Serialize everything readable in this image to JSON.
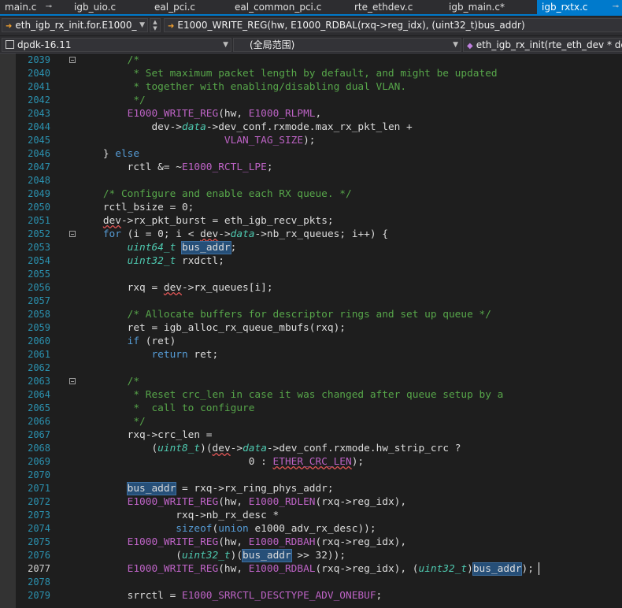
{
  "tabs": [
    {
      "label": "main.c",
      "active": false,
      "pinned": true
    },
    {
      "label": "igb_uio.c",
      "active": false,
      "pinned": false
    },
    {
      "label": "eal_pci.c",
      "active": false,
      "pinned": false
    },
    {
      "label": "eal_common_pci.c",
      "active": false,
      "pinned": false
    },
    {
      "label": "rte_ethdev.c",
      "active": false,
      "pinned": false
    },
    {
      "label": "igb_main.c*",
      "active": false,
      "pinned": false
    },
    {
      "label": "igb_rxtx.c",
      "active": true,
      "pinned": true
    }
  ],
  "nav": {
    "function_combo": "eth_igb_rx_init.for.E1000_",
    "member_combo": "E1000_WRITE_REG(hw, E1000_RDBAL(rxq->reg_idx), (uint32_t)bus_addr)"
  },
  "scope": {
    "project": "dpdk-16.11",
    "scope_label": "(全局范围)",
    "function": "eth_igb_rx_init(rte_eth_dev * dev"
  },
  "gutter": {
    "line_numbers": [
      "2039",
      "2040",
      "2041",
      "2042",
      "2043",
      "2044",
      "2045",
      "2046",
      "2047",
      "2048",
      "2049",
      "2050",
      "2051",
      "2052",
      "2053",
      "2054",
      "2055",
      "2056",
      "2057",
      "2058",
      "2059",
      "2060",
      "2061",
      "2062",
      "2063",
      "2064",
      "2065",
      "2066",
      "2067",
      "2068",
      "2069",
      "2070",
      "2071",
      "2072",
      "2073",
      "2074",
      "2075",
      "2076",
      "2077",
      "2078",
      "2079"
    ],
    "current_line": "2077"
  },
  "code_lines": [
    [
      {
        "t": "        "
      },
      {
        "t": "/*",
        "c": "cm"
      }
    ],
    [
      {
        "t": "         "
      },
      {
        "t": "* Set maximum packet length by default, and might be updated",
        "c": "cm"
      }
    ],
    [
      {
        "t": "         "
      },
      {
        "t": "* together with enabling/disabling dual VLAN.",
        "c": "cm"
      }
    ],
    [
      {
        "t": "         "
      },
      {
        "t": "*/",
        "c": "cm"
      }
    ],
    [
      {
        "t": "        "
      },
      {
        "t": "E1000_WRITE_REG",
        "c": "mac"
      },
      {
        "t": "(hw, "
      },
      {
        "t": "E1000_RLPML",
        "c": "mac"
      },
      {
        "t": ","
      }
    ],
    [
      {
        "t": "            dev->"
      },
      {
        "t": "data",
        "c": "ty"
      },
      {
        "t": "->dev_conf.rxmode.max_rx_pkt_len +"
      }
    ],
    [
      {
        "t": "                        "
      },
      {
        "t": "VLAN_TAG_SIZE",
        "c": "mac"
      },
      {
        "t": ");"
      }
    ],
    [
      {
        "t": "    } "
      },
      {
        "t": "else",
        "c": "kw"
      }
    ],
    [
      {
        "t": "        rctl &= ~"
      },
      {
        "t": "E1000_RCTL_LPE",
        "c": "mac"
      },
      {
        "t": ";"
      }
    ],
    [
      {
        "t": ""
      }
    ],
    [
      {
        "t": "    "
      },
      {
        "t": "/* Configure and enable each RX queue. */",
        "c": "cm"
      }
    ],
    [
      {
        "t": "    rctl_bsize = 0;"
      }
    ],
    [
      {
        "t": "    "
      },
      {
        "t": "dev",
        "s": true
      },
      {
        "t": "->rx_pkt_burst = eth_igb_recv_pkts;"
      }
    ],
    [
      {
        "t": "    "
      },
      {
        "t": "for",
        "c": "kw"
      },
      {
        "t": " (i = 0; i < "
      },
      {
        "t": "dev",
        "s": true
      },
      {
        "t": "->"
      },
      {
        "t": "data",
        "c": "ty"
      },
      {
        "t": "->nb_rx_queues; i++) {"
      }
    ],
    [
      {
        "t": "        "
      },
      {
        "t": "uint64_t",
        "c": "ty"
      },
      {
        "t": " "
      },
      {
        "t": "bus_addr",
        "h": true
      },
      {
        "t": ";"
      }
    ],
    [
      {
        "t": "        "
      },
      {
        "t": "uint32_t",
        "c": "ty"
      },
      {
        "t": " rxdctl;"
      }
    ],
    [
      {
        "t": ""
      }
    ],
    [
      {
        "t": "        rxq = "
      },
      {
        "t": "dev",
        "s": true
      },
      {
        "t": "->rx_queues[i];"
      }
    ],
    [
      {
        "t": ""
      }
    ],
    [
      {
        "t": "        "
      },
      {
        "t": "/* Allocate buffers for descriptor rings and set up queue */",
        "c": "cm"
      }
    ],
    [
      {
        "t": "        ret = igb_alloc_rx_queue_mbufs(rxq);"
      }
    ],
    [
      {
        "t": "        "
      },
      {
        "t": "if",
        "c": "kw"
      },
      {
        "t": " (ret)"
      }
    ],
    [
      {
        "t": "            "
      },
      {
        "t": "return",
        "c": "kw"
      },
      {
        "t": " ret;"
      }
    ],
    [
      {
        "t": ""
      }
    ],
    [
      {
        "t": "        "
      },
      {
        "t": "/*",
        "c": "cm"
      }
    ],
    [
      {
        "t": "         "
      },
      {
        "t": "* Reset crc_len in case it was changed after queue setup by a",
        "c": "cm"
      }
    ],
    [
      {
        "t": "         "
      },
      {
        "t": "*  call to configure",
        "c": "cm"
      }
    ],
    [
      {
        "t": "         "
      },
      {
        "t": "*/",
        "c": "cm"
      }
    ],
    [
      {
        "t": "        rxq->crc_len ="
      }
    ],
    [
      {
        "t": "            ("
      },
      {
        "t": "uint8_t",
        "c": "ty"
      },
      {
        "t": ")("
      },
      {
        "t": "dev",
        "s": true
      },
      {
        "t": "->"
      },
      {
        "t": "data",
        "c": "ty"
      },
      {
        "t": "->dev_conf.rxmode.hw_strip_crc ?"
      }
    ],
    [
      {
        "t": "                            0 : "
      },
      {
        "t": "ETHER_CRC_LEN",
        "c": "mac",
        "s": true
      },
      {
        "t": ");"
      }
    ],
    [
      {
        "t": ""
      }
    ],
    [
      {
        "t": "        "
      },
      {
        "t": "bus_addr",
        "h": true
      },
      {
        "t": " = rxq->rx_ring_phys_addr;"
      }
    ],
    [
      {
        "t": "        "
      },
      {
        "t": "E1000_WRITE_REG",
        "c": "mac"
      },
      {
        "t": "(hw, "
      },
      {
        "t": "E1000_RDLEN",
        "c": "mac"
      },
      {
        "t": "(rxq->reg_idx),"
      }
    ],
    [
      {
        "t": "                rxq->nb_rx_desc *"
      }
    ],
    [
      {
        "t": "                "
      },
      {
        "t": "sizeof",
        "c": "kw"
      },
      {
        "t": "("
      },
      {
        "t": "union",
        "c": "kw"
      },
      {
        "t": " e1000_adv_rx_desc));"
      }
    ],
    [
      {
        "t": "        "
      },
      {
        "t": "E1000_WRITE_REG",
        "c": "mac"
      },
      {
        "t": "(hw, "
      },
      {
        "t": "E1000_RDBAH",
        "c": "mac"
      },
      {
        "t": "(rxq->reg_idx),"
      }
    ],
    [
      {
        "t": "                ("
      },
      {
        "t": "uint32_t",
        "c": "ty"
      },
      {
        "t": ")("
      },
      {
        "t": "bus_addr",
        "h": true
      },
      {
        "t": " >> 32));"
      }
    ],
    [
      {
        "t": "        "
      },
      {
        "t": "E1000_WRITE_REG",
        "c": "mac"
      },
      {
        "t": "(hw, "
      },
      {
        "t": "E1000_RDBAL",
        "c": "mac"
      },
      {
        "t": "(rxq->reg_idx), ("
      },
      {
        "t": "uint32_t",
        "c": "ty"
      },
      {
        "t": ")"
      },
      {
        "t": "bus_addr",
        "h": true
      },
      {
        "t": ");"
      }
    ],
    [
      {
        "t": ""
      }
    ],
    [
      {
        "t": "        srrctl = "
      },
      {
        "t": "E1000_SRRCTL_DESCTYPE_ADV_ONEBUF",
        "c": "mac"
      },
      {
        "t": ";"
      }
    ]
  ],
  "fold_markers": [
    "2039",
    "2052",
    "2063"
  ],
  "colors": {
    "accent": "#007acc",
    "editor_bg": "#1e1e1e",
    "line_number": "#2b91af",
    "comment": "#57a64a",
    "keyword": "#569cd6",
    "macro": "#bd63c5",
    "type": "#4ec9b0",
    "highlight": "#264f78"
  },
  "icons": {
    "pin": "pin-icon",
    "nav_lead": "arrow-right-icon",
    "project": "project-icon",
    "close": "close-icon"
  }
}
